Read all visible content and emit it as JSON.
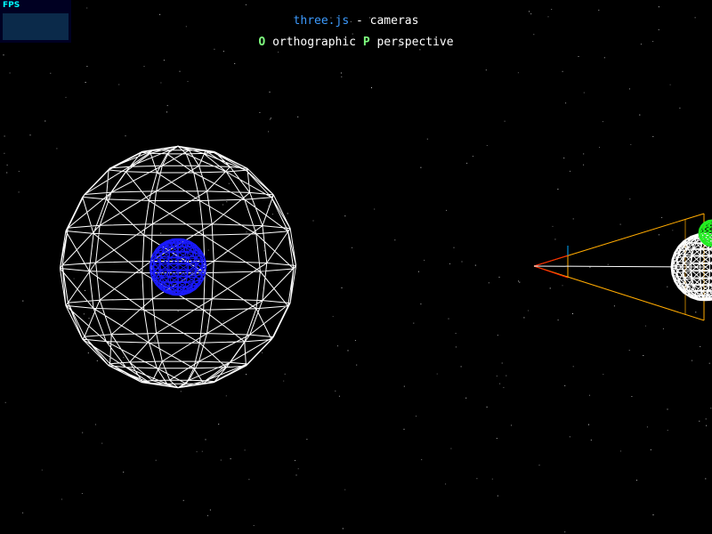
{
  "header": {
    "title_link": "three.js",
    "title_rest": " - cameras",
    "key_ortho": "O",
    "label_ortho": " orthographic ",
    "key_persp": "P",
    "label_persp": " perspective"
  },
  "stats": {
    "label": "FPS"
  },
  "colors": {
    "background": "#000000",
    "link": "#3d9bff",
    "key": "#7fff7f",
    "wireframe_large": "#ffffff",
    "wireframe_inner": "#0000ff",
    "wireframe_small": "#00ff00",
    "frustum": "#ffaa00",
    "frustum_near": "#ff0000",
    "camera_up": "#00aaff",
    "stars": "#888888"
  }
}
